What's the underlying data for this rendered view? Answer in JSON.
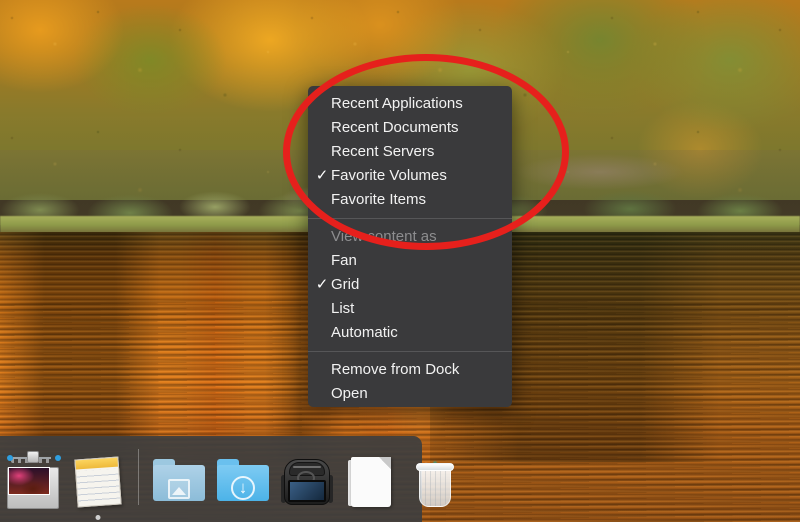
{
  "desktop": {
    "wallpaper_name": "autumn-lake-wallpaper",
    "wallpaper_alt": "Autumn trees reflected in an orange lake"
  },
  "context_menu": {
    "name": "dock-stack-context-menu",
    "groups": [
      {
        "name": "display-content-group",
        "items": [
          {
            "label": "Recent Applications",
            "checked": false,
            "disabled": false
          },
          {
            "label": "Recent Documents",
            "checked": false,
            "disabled": false
          },
          {
            "label": "Recent Servers",
            "checked": false,
            "disabled": false
          },
          {
            "label": "Favorite Volumes",
            "checked": true,
            "disabled": false
          },
          {
            "label": "Favorite Items",
            "checked": false,
            "disabled": false
          }
        ]
      },
      {
        "name": "view-content-as-group",
        "items": [
          {
            "label": "View content as",
            "checked": false,
            "disabled": true
          },
          {
            "label": "Fan",
            "checked": false,
            "disabled": false
          },
          {
            "label": "Grid",
            "checked": true,
            "disabled": false
          },
          {
            "label": "List",
            "checked": false,
            "disabled": false
          },
          {
            "label": "Automatic",
            "checked": false,
            "disabled": false
          }
        ]
      },
      {
        "name": "actions-group",
        "items": [
          {
            "label": "Remove from Dock",
            "checked": false,
            "disabled": false
          },
          {
            "label": "Open",
            "checked": false,
            "disabled": false
          }
        ]
      }
    ],
    "check_glyph": "✓"
  },
  "annotation": {
    "name": "red-ellipse-highlight",
    "color": "#e6201c",
    "stroke_width_px": 7
  },
  "dock": {
    "name": "macos-dock",
    "background_color": "#3e3e3e",
    "items": [
      {
        "name": "image-capture-icon",
        "label": "Image Capture",
        "icon": "camera-scanner-icon",
        "running": false
      },
      {
        "name": "notes-icon",
        "label": "Notes",
        "icon": "notepad-icon",
        "running": true
      },
      {
        "name": "pictures-folder-icon",
        "label": "Pictures",
        "icon": "folder-pictures-icon",
        "running": false
      },
      {
        "name": "downloads-folder-icon",
        "label": "Downloads",
        "icon": "folder-downloads-icon",
        "running": false
      },
      {
        "name": "backpack-stack-icon",
        "label": "Backpack",
        "icon": "backpack-icon",
        "running": false
      },
      {
        "name": "document-icon",
        "label": "Document",
        "icon": "document-page-icon",
        "running": false
      },
      {
        "name": "trash-icon",
        "label": "Trash",
        "icon": "trash-can-icon",
        "running": false
      }
    ]
  }
}
